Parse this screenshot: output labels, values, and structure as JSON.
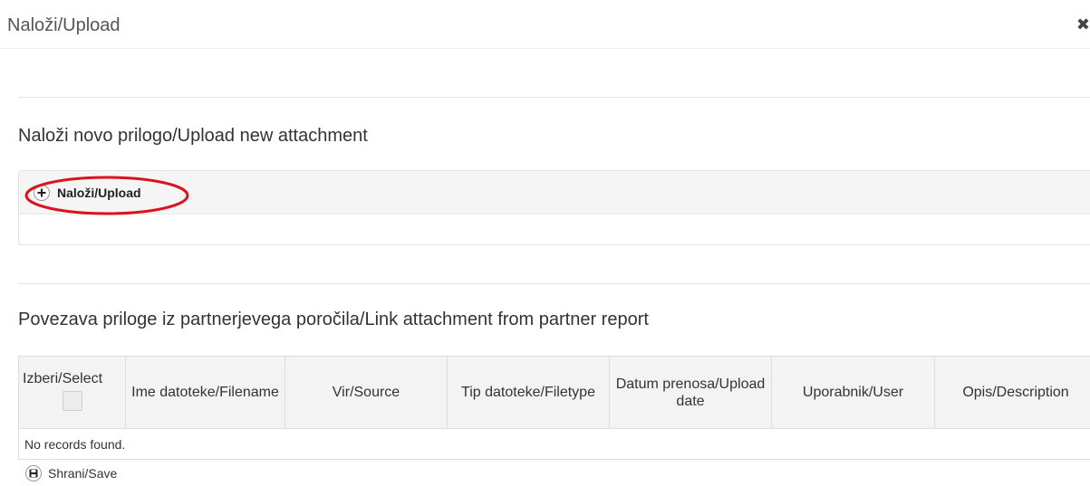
{
  "dialog": {
    "title": "Naloži/Upload",
    "close_icon": "times-icon"
  },
  "upload_section": {
    "title": "Naloži novo prilogo/Upload new attachment",
    "button_label": "Naloži/Upload",
    "button_icon": "plus-circle-icon",
    "highlight_color": "#d9141e"
  },
  "link_section": {
    "title": "Povezava priloge iz partnerjevega poročila/Link attachment from partner report",
    "table": {
      "columns": [
        "Izberi/Select",
        "Ime datoteke/Filename",
        "Vir/Source",
        "Tip datoteke/Filetype",
        "Datum prenosa/Upload date",
        "Uporabnik/User",
        "Opis/Description"
      ],
      "empty_message": "No records found."
    }
  },
  "footer": {
    "save_label": "Shrani/Save",
    "save_icon": "floppy-disk-icon"
  }
}
